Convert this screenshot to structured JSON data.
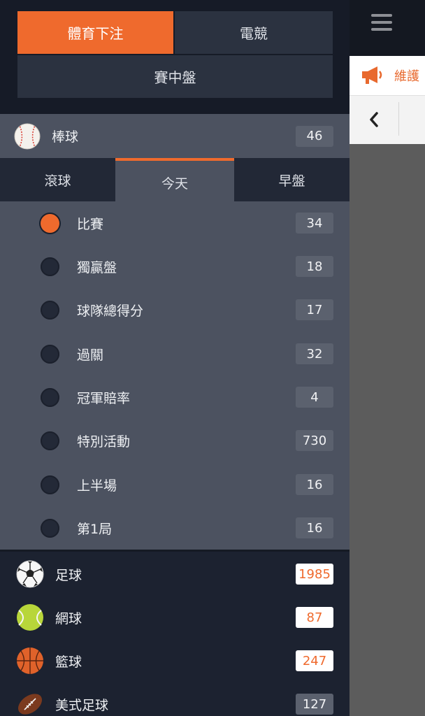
{
  "background": {
    "maintenance_label": "維護",
    "icons": [
      "hamburger-menu-icon",
      "megaphone-icon",
      "chevron-left-icon"
    ]
  },
  "drawer": {
    "segments": {
      "sports": "體育下注",
      "esports": "電競",
      "in_play": "賽中盤"
    },
    "active_sport": {
      "name": "棒球",
      "count": "46",
      "icon": "baseball-icon"
    },
    "tabs": {
      "rolling": "滾球",
      "today": "今天",
      "early": "早盤",
      "active": "today"
    },
    "sub_items": [
      {
        "label": "比賽",
        "count": "34",
        "selected": true
      },
      {
        "label": "獨贏盤",
        "count": "18",
        "selected": false
      },
      {
        "label": "球隊總得分",
        "count": "17",
        "selected": false
      },
      {
        "label": "過關",
        "count": "32",
        "selected": false
      },
      {
        "label": "冠軍賠率",
        "count": "4",
        "selected": false
      },
      {
        "label": "特別活動",
        "count": "730",
        "selected": false
      },
      {
        "label": "上半場",
        "count": "16",
        "selected": false
      },
      {
        "label": "第1局",
        "count": "16",
        "selected": false
      }
    ],
    "sports": [
      {
        "name": "足球",
        "count": "1985",
        "highlight": true,
        "icon": "soccer-ball-icon"
      },
      {
        "name": "網球",
        "count": "87",
        "highlight": true,
        "icon": "tennis-ball-icon"
      },
      {
        "name": "籃球",
        "count": "247",
        "highlight": true,
        "icon": "basketball-icon"
      },
      {
        "name": "美式足球",
        "count": "127",
        "highlight": false,
        "icon": "american-football-icon"
      }
    ]
  },
  "colors": {
    "accent": "#ef6a2d",
    "drawer_bg": "#1c2230",
    "panel_bg": "#4c5260"
  }
}
